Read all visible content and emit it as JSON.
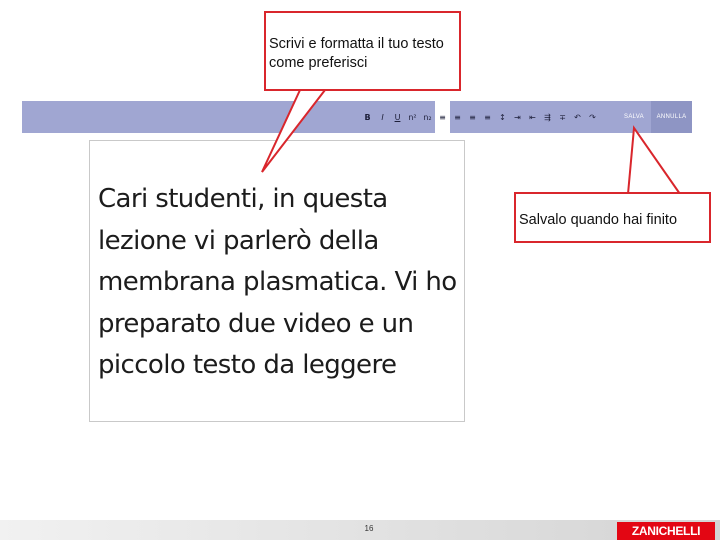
{
  "toolbar": {
    "buttons": [
      {
        "name": "bold-icon",
        "glyph": "B"
      },
      {
        "name": "italic-icon",
        "glyph": "I"
      },
      {
        "name": "underline-icon",
        "glyph": "U"
      },
      {
        "name": "superscript-icon",
        "glyph": "n²"
      },
      {
        "name": "subscript-icon",
        "glyph": "n₂"
      },
      {
        "name": "align-left-icon",
        "glyph": "≡"
      },
      {
        "name": "align-center-icon",
        "glyph": "≡"
      },
      {
        "name": "align-right-icon",
        "glyph": "≡"
      },
      {
        "name": "align-justify-icon",
        "glyph": "≡"
      },
      {
        "name": "line-spacing-icon",
        "glyph": "↕"
      },
      {
        "name": "indent-icon",
        "glyph": "⇥"
      },
      {
        "name": "outdent-icon",
        "glyph": "⇤"
      },
      {
        "name": "list-indent-icon",
        "glyph": "⇶"
      },
      {
        "name": "strikethrough-icon",
        "glyph": "∓"
      },
      {
        "name": "undo-icon",
        "glyph": "↶"
      },
      {
        "name": "redo-icon",
        "glyph": "↷"
      }
    ],
    "save_label": "SALVA",
    "cancel_label": "ANNULLA"
  },
  "editor": {
    "text": "Cari studenti, in questa lezione vi parlerò della membrana plasmatica. Vi ho preparato due video e un piccolo testo da leggere"
  },
  "callouts": {
    "format": "Scrivi e formatta il tuo testo come preferisci",
    "save": "Salvalo quando hai finito"
  },
  "footer": {
    "page_number": "16",
    "logo": "ZANICHELLI"
  },
  "colors": {
    "toolbar": "#a0a6d2",
    "callout_border": "#d9262c",
    "logo": "#e30613"
  }
}
